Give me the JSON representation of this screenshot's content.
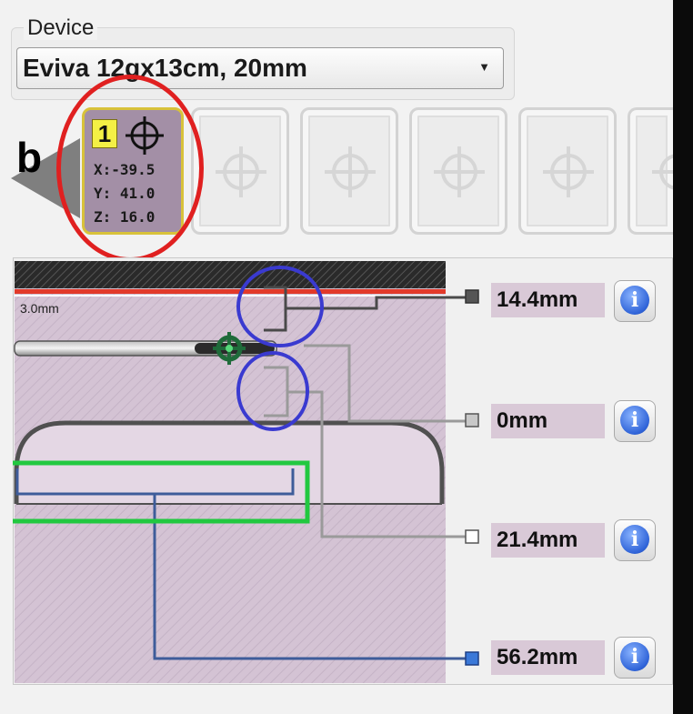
{
  "device": {
    "legend": "Device",
    "selected": "Eviva 12gx13cm, 20mm"
  },
  "annotation": {
    "panel_label": "b"
  },
  "targets": {
    "active": {
      "number": "1",
      "x": "X:-39.5",
      "y": "Y: 41.0",
      "z": "Z: 16.0"
    },
    "slot_icons": [
      "crosshair-icon",
      "crosshair-icon",
      "crosshair-icon",
      "crosshair-icon",
      "crosshair-icon"
    ]
  },
  "diagram": {
    "scale_label": "3.0mm",
    "measurements": [
      {
        "value": "14.4mm",
        "marker_color": "#555555"
      },
      {
        "value": "0mm",
        "marker_color": "#c8c8c8"
      },
      {
        "value": "21.4mm",
        "marker_color": "#ffffff"
      },
      {
        "value": "56.2mm",
        "marker_color": "#3a78d8"
      }
    ],
    "info_label": "i"
  },
  "colors": {
    "tissue": "#d7c7d7",
    "skin_line": "#e23a2a",
    "highlight_red": "#e02020",
    "highlight_blue": "#3a3ad0",
    "highlight_green": "#22c840",
    "lead_blue": "#3e5c9a"
  }
}
